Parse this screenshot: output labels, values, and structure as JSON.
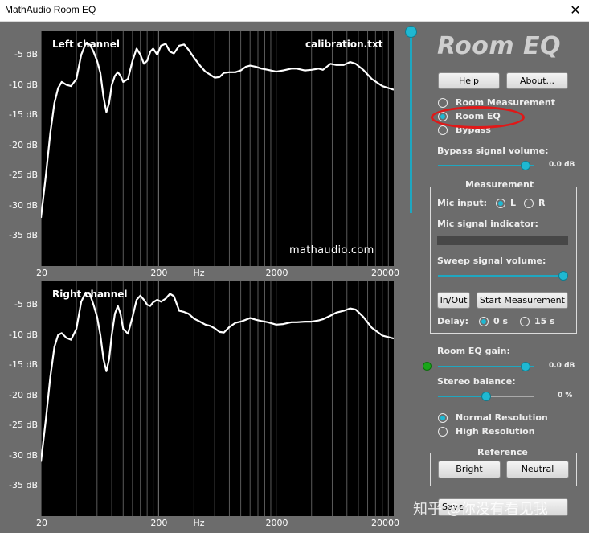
{
  "window": {
    "title": "MathAudio Room EQ",
    "close_glyph": "✕"
  },
  "brand": "Room EQ",
  "buttons": {
    "help": "Help",
    "about": "About...",
    "in_out": "In/Out",
    "start_measurement": "Start Measurement",
    "bright": "Bright",
    "neutral": "Neutral",
    "save_partial": "Save"
  },
  "mode": {
    "options": [
      "Room Measurement",
      "Room EQ",
      "Bypass"
    ],
    "selected": "Room EQ"
  },
  "bypass_volume": {
    "label": "Bypass signal volume:",
    "value": "0.0 dB",
    "level": 0.92
  },
  "measurement": {
    "title": "Measurement",
    "mic_input_label": "Mic input:",
    "mic_left": "L",
    "mic_right": "R",
    "mic_selected": "L",
    "mic_indicator_label": "Mic signal indicator:",
    "sweep_label": "Sweep signal volume:",
    "sweep_level": 1.0,
    "delay_label": "Delay:",
    "delay_options": [
      "0 s",
      "15 s"
    ],
    "delay_selected": "0 s"
  },
  "eq_gain": {
    "label": "Room EQ gain:",
    "value": "0.0 dB",
    "level": 0.92
  },
  "stereo_balance": {
    "label": "Stereo balance:",
    "value": "0 %",
    "level": 0.5
  },
  "resolution": {
    "options": [
      "Normal Resolution",
      "High Resolution"
    ],
    "selected": "Normal Resolution"
  },
  "reference": {
    "title": "Reference"
  },
  "watermark": "知乎 @你没有看见我",
  "colors": {
    "accent": "#1fb8d2",
    "panel_bg": "#6c6c6c",
    "plot_bg": "#000000",
    "highlight_circle": "#e01818",
    "status_dot": "#1aa61a"
  },
  "charts": {
    "left": {
      "title": "Left channel",
      "file": "calibration.txt",
      "site": "mathaudio.com",
      "y_ticks": [
        "-5 dB",
        "-10 dB",
        "-15 dB",
        "-20 dB",
        "-25 dB",
        "-30 dB",
        "-35 dB"
      ],
      "x_ticks": [
        "20",
        "200",
        "Hz",
        "2000",
        "20000"
      ]
    },
    "right": {
      "title": "Right channel",
      "y_ticks": [
        "-5 dB",
        "-10 dB",
        "-15 dB",
        "-20 dB",
        "-25 dB",
        "-30 dB",
        "-35 dB"
      ],
      "x_ticks": [
        "20",
        "200",
        "Hz",
        "2000",
        "20000"
      ]
    }
  },
  "chart_data": [
    {
      "type": "line",
      "title": "Left channel",
      "xlabel": "Hz",
      "ylabel": "",
      "x_scale": "log",
      "xlim": [
        20,
        20000
      ],
      "ylim": [
        -40,
        -1
      ],
      "grid": true,
      "series": [
        {
          "values_hz_db": [
            [
              20,
              -32
            ],
            [
              22,
              -25
            ],
            [
              24,
              -18
            ],
            [
              26,
              -13
            ],
            [
              28,
              -10.5
            ],
            [
              30,
              -9.5
            ],
            [
              33,
              -10
            ],
            [
              36,
              -10.2
            ],
            [
              40,
              -9
            ],
            [
              44,
              -5
            ],
            [
              48,
              -3.2
            ],
            [
              52,
              -3.3
            ],
            [
              56,
              -4.5
            ],
            [
              60,
              -6
            ],
            [
              64,
              -8
            ],
            [
              68,
              -12
            ],
            [
              72,
              -14.5
            ],
            [
              76,
              -13
            ],
            [
              80,
              -10
            ],
            [
              85,
              -8.5
            ],
            [
              90,
              -7.9
            ],
            [
              95,
              -8.5
            ],
            [
              100,
              -9.5
            ],
            [
              110,
              -9
            ],
            [
              120,
              -6
            ],
            [
              130,
              -4
            ],
            [
              140,
              -5
            ],
            [
              150,
              -6.5
            ],
            [
              160,
              -6
            ],
            [
              170,
              -4.5
            ],
            [
              180,
              -4
            ],
            [
              195,
              -5
            ],
            [
              210,
              -3.5
            ],
            [
              230,
              -3.2
            ],
            [
              250,
              -4.5
            ],
            [
              270,
              -4.8
            ],
            [
              300,
              -3.5
            ],
            [
              330,
              -3.3
            ],
            [
              360,
              -4.2
            ],
            [
              400,
              -5.5
            ],
            [
              450,
              -6.8
            ],
            [
              500,
              -7.8
            ],
            [
              550,
              -8.3
            ],
            [
              600,
              -8.8
            ],
            [
              660,
              -8.7
            ],
            [
              720,
              -8
            ],
            [
              800,
              -7.9
            ],
            [
              900,
              -7.9
            ],
            [
              1000,
              -7.6
            ],
            [
              1100,
              -7
            ],
            [
              1200,
              -6.8
            ],
            [
              1350,
              -7
            ],
            [
              1500,
              -7.3
            ],
            [
              1700,
              -7.5
            ],
            [
              2000,
              -7.8
            ],
            [
              2300,
              -7.6
            ],
            [
              2700,
              -7.3
            ],
            [
              3000,
              -7.3
            ],
            [
              3500,
              -7.6
            ],
            [
              4000,
              -7.5
            ],
            [
              4600,
              -7.3
            ],
            [
              5000,
              -7.5
            ],
            [
              5800,
              -6.5
            ],
            [
              6500,
              -6.7
            ],
            [
              7500,
              -6.7
            ],
            [
              8500,
              -6.2
            ],
            [
              9500,
              -6.5
            ],
            [
              11000,
              -7.5
            ],
            [
              13000,
              -9
            ],
            [
              16000,
              -10.2
            ],
            [
              20000,
              -10.8
            ]
          ]
        }
      ]
    },
    {
      "type": "line",
      "title": "Right channel",
      "xlabel": "Hz",
      "ylabel": "",
      "x_scale": "log",
      "xlim": [
        20,
        20000
      ],
      "ylim": [
        -40,
        -1
      ],
      "grid": true,
      "series": [
        {
          "values_hz_db": [
            [
              20,
              -31
            ],
            [
              22,
              -24
            ],
            [
              24,
              -17
            ],
            [
              26,
              -12
            ],
            [
              28,
              -10
            ],
            [
              30,
              -9.7
            ],
            [
              33,
              -10.5
            ],
            [
              36,
              -10.8
            ],
            [
              40,
              -9
            ],
            [
              44,
              -4.5
            ],
            [
              48,
              -3
            ],
            [
              52,
              -3.2
            ],
            [
              56,
              -5
            ],
            [
              60,
              -7
            ],
            [
              64,
              -10
            ],
            [
              68,
              -14
            ],
            [
              72,
              -16
            ],
            [
              76,
              -14
            ],
            [
              80,
              -10
            ],
            [
              85,
              -6.5
            ],
            [
              90,
              -5.2
            ],
            [
              95,
              -6.5
            ],
            [
              100,
              -9
            ],
            [
              110,
              -9.8
            ],
            [
              120,
              -7
            ],
            [
              130,
              -4.2
            ],
            [
              140,
              -3.5
            ],
            [
              150,
              -4.2
            ],
            [
              160,
              -5
            ],
            [
              170,
              -5.2
            ],
            [
              180,
              -4.6
            ],
            [
              195,
              -4.2
            ],
            [
              210,
              -4.5
            ],
            [
              230,
              -4
            ],
            [
              250,
              -3.2
            ],
            [
              270,
              -3.6
            ],
            [
              300,
              -6
            ],
            [
              330,
              -6.2
            ],
            [
              360,
              -6.5
            ],
            [
              400,
              -7.3
            ],
            [
              450,
              -7.8
            ],
            [
              500,
              -8.3
            ],
            [
              550,
              -8.5
            ],
            [
              600,
              -8.9
            ],
            [
              660,
              -9.5
            ],
            [
              720,
              -9.6
            ],
            [
              800,
              -8.7
            ],
            [
              900,
              -8
            ],
            [
              1000,
              -7.8
            ],
            [
              1100,
              -7.5
            ],
            [
              1200,
              -7.2
            ],
            [
              1350,
              -7.5
            ],
            [
              1500,
              -7.7
            ],
            [
              1700,
              -7.9
            ],
            [
              2000,
              -8.3
            ],
            [
              2300,
              -8.2
            ],
            [
              2700,
              -7.9
            ],
            [
              3000,
              -7.9
            ],
            [
              3500,
              -7.8
            ],
            [
              4000,
              -7.8
            ],
            [
              4600,
              -7.6
            ],
            [
              5000,
              -7.4
            ],
            [
              5800,
              -6.8
            ],
            [
              6500,
              -6.3
            ],
            [
              7500,
              -6
            ],
            [
              8500,
              -5.6
            ],
            [
              9500,
              -5.8
            ],
            [
              11000,
              -7
            ],
            [
              13000,
              -8.8
            ],
            [
              16000,
              -10.1
            ],
            [
              20000,
              -10.6
            ]
          ]
        }
      ]
    }
  ]
}
